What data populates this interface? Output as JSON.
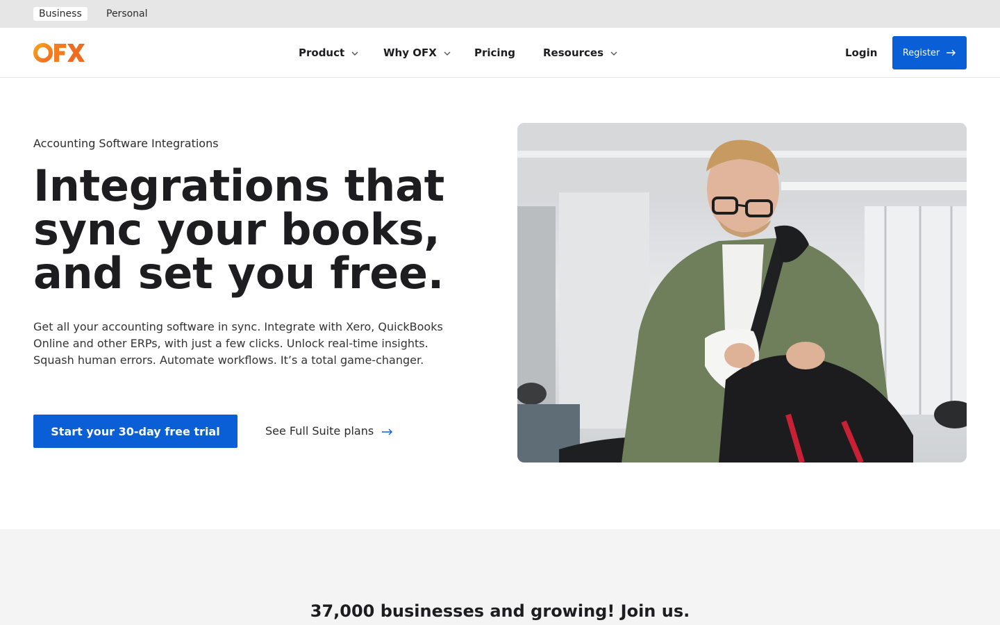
{
  "audience": {
    "tabs": [
      {
        "label": "Business",
        "active": true
      },
      {
        "label": "Personal",
        "active": false
      }
    ]
  },
  "header": {
    "logo_text": "OFX",
    "nav": [
      {
        "label": "Product",
        "icon": "chevron-down-icon"
      },
      {
        "label": "Why OFX",
        "icon": "chevron-down-icon"
      },
      {
        "label": "Pricing"
      },
      {
        "label": "Resources",
        "icon": "chevron-down-icon"
      }
    ],
    "login_label": "Login",
    "register_label": "Register",
    "register_icon": "arrow-right-icon"
  },
  "hero": {
    "eyebrow": "Accounting Software Integrations",
    "title": "Integrations that sync your books, and set you free.",
    "body": "Get all your accounting software in sync. Integrate with Xero, QuickBooks Online and other ERPs, with just a few clicks. Unlock real-time insights. Squash human errors. Automate workflows. It’s a total game-changer.",
    "cta_primary": "Start your 30-day free trial",
    "cta_secondary": "See Full Suite plans",
    "cta_secondary_icon": "arrow-right-icon"
  },
  "proof": {
    "title": "37,000 businesses and growing! Join us."
  },
  "colors": {
    "brand_orange": "#f47b20",
    "primary_blue": "#0b5fd6",
    "link_arrow_blue": "#0b5fd6"
  }
}
